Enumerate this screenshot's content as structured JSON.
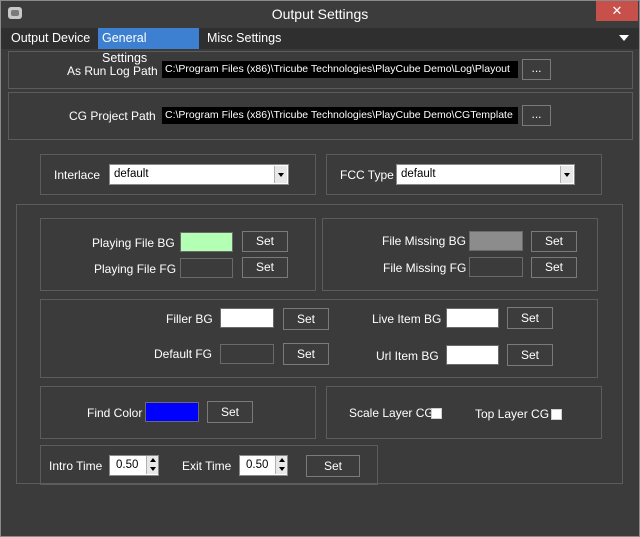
{
  "window": {
    "title": "Output Settings",
    "close_glyph": "✕",
    "app_icon": "app-icon"
  },
  "tabs": [
    {
      "label": "Output Device",
      "active": false
    },
    {
      "label": "General Settings",
      "active": true
    },
    {
      "label": "Misc Settings",
      "active": false
    }
  ],
  "paths": {
    "as_run_log": {
      "label": "As Run Log  Path",
      "value": "C:\\Program Files (x86)\\Tricube Technologies\\PlayCube Demo\\Log\\Playout",
      "browse_label": "..."
    },
    "cg_project": {
      "label": "CG Project Path",
      "value": "C:\\Program Files (x86)\\Tricube Technologies\\PlayCube Demo\\CGTemplate",
      "browse_label": "..."
    }
  },
  "interlace": {
    "label": "Interlace",
    "value": "default"
  },
  "fcc_type": {
    "label": "FCC Type",
    "value": "default"
  },
  "colors": {
    "playing_file_bg": {
      "label": "Playing File BG",
      "color": "#b3ffb3",
      "button": "Set"
    },
    "playing_file_fg": {
      "label": "Playing File FG",
      "color": "#3b3b3b",
      "button": "Set"
    },
    "file_missing_bg": {
      "label": "File Missing BG",
      "color": "#8c8c8c",
      "button": "Set"
    },
    "file_missing_fg": {
      "label": "File Missing FG",
      "color": "#3b3b3b",
      "button": "Set"
    },
    "filler_bg": {
      "label": "Filler BG",
      "color": "#ffffff",
      "button": "Set"
    },
    "default_fg": {
      "label": "Default FG",
      "color": "#3b3b3b",
      "button": "Set"
    },
    "live_item_bg": {
      "label": "Live Item BG",
      "color": "#ffffff",
      "button": "Set"
    },
    "url_item_bg": {
      "label": "Url  Item BG",
      "color": "#ffffff",
      "button": "Set"
    },
    "find_color": {
      "label": "Find Color",
      "color": "#0000ff",
      "button": "Set"
    }
  },
  "layers": {
    "scale_layer_cg": {
      "label": "Scale Layer CG",
      "checked": false
    },
    "top_layer_cg": {
      "label": "Top Layer  CG",
      "checked": false
    }
  },
  "timing": {
    "intro_time": {
      "label": "Intro Time",
      "value": "0.50"
    },
    "exit_time": {
      "label": "Exit Time",
      "value": "0.50"
    },
    "set_label": "Set"
  }
}
